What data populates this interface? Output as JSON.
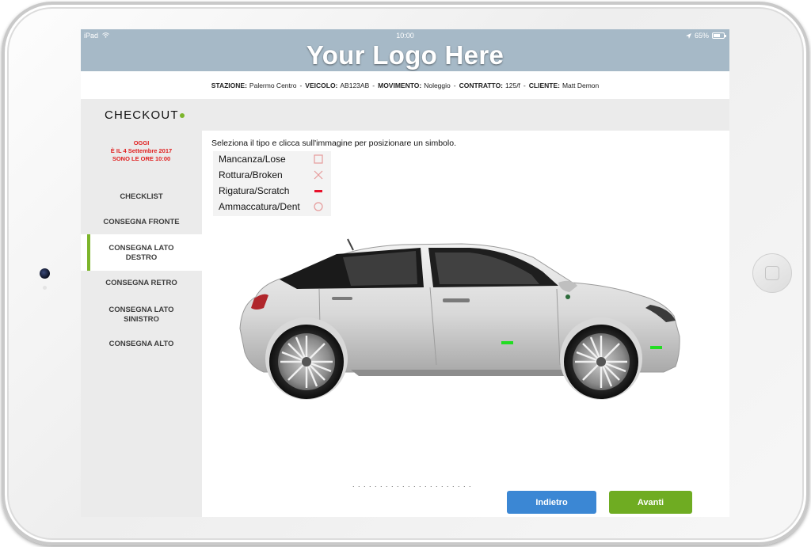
{
  "status_bar": {
    "device": "iPad",
    "time": "10:00",
    "battery": "65%",
    "battery_level": 0.65
  },
  "header": {
    "logo": "Your Logo Here"
  },
  "info": {
    "stazione_label": "STAZIONE:",
    "stazione": "Palermo Centro",
    "veicolo_label": "VEICOLO:",
    "veicolo": "AB123AB",
    "movimento_label": "MOVIMENTO:",
    "movimento": "Noleggio",
    "contratto_label": "CONTRATTO:",
    "contratto": "125/f",
    "cliente_label": "CLIENTE:",
    "cliente": "Matt Demon",
    "separator": "-"
  },
  "page": {
    "title": "CHECKOUT"
  },
  "sidebar": {
    "today_line1": "OGGI",
    "today_line2": "È IL 4 Settembre 2017",
    "today_line3": "SONO LE ORE 10:00",
    "items": [
      {
        "label": "CHECKLIST"
      },
      {
        "label": "CONSEGNA FRONTE"
      },
      {
        "label": "CONSEGNA LATO DESTRO",
        "active": true
      },
      {
        "label": "CONSEGNA RETRO"
      },
      {
        "label": "CONSEGNA LATO SINISTRO"
      },
      {
        "label": "CONSEGNA ALTO"
      }
    ]
  },
  "main": {
    "instruction": "Seleziona il tipo e clicca sull'immagine per posizionare un simbolo.",
    "legend": [
      {
        "label": "Mancanza/Lose",
        "icon": "square-icon"
      },
      {
        "label": "Rottura/Broken",
        "icon": "cross-icon"
      },
      {
        "label": "Rigatura/Scratch",
        "icon": "dash-icon"
      },
      {
        "label": "Ammaccatura/Dent",
        "icon": "circle-icon"
      }
    ],
    "back_label": "Indietro",
    "next_label": "Avanti"
  },
  "colors": {
    "header": "#a6b9c7",
    "accent_green": "#7cb52b",
    "button_blue": "#3b87d4",
    "button_green": "#6fac22",
    "date_red": "#e02020",
    "marker_green": "#22dd22"
  }
}
